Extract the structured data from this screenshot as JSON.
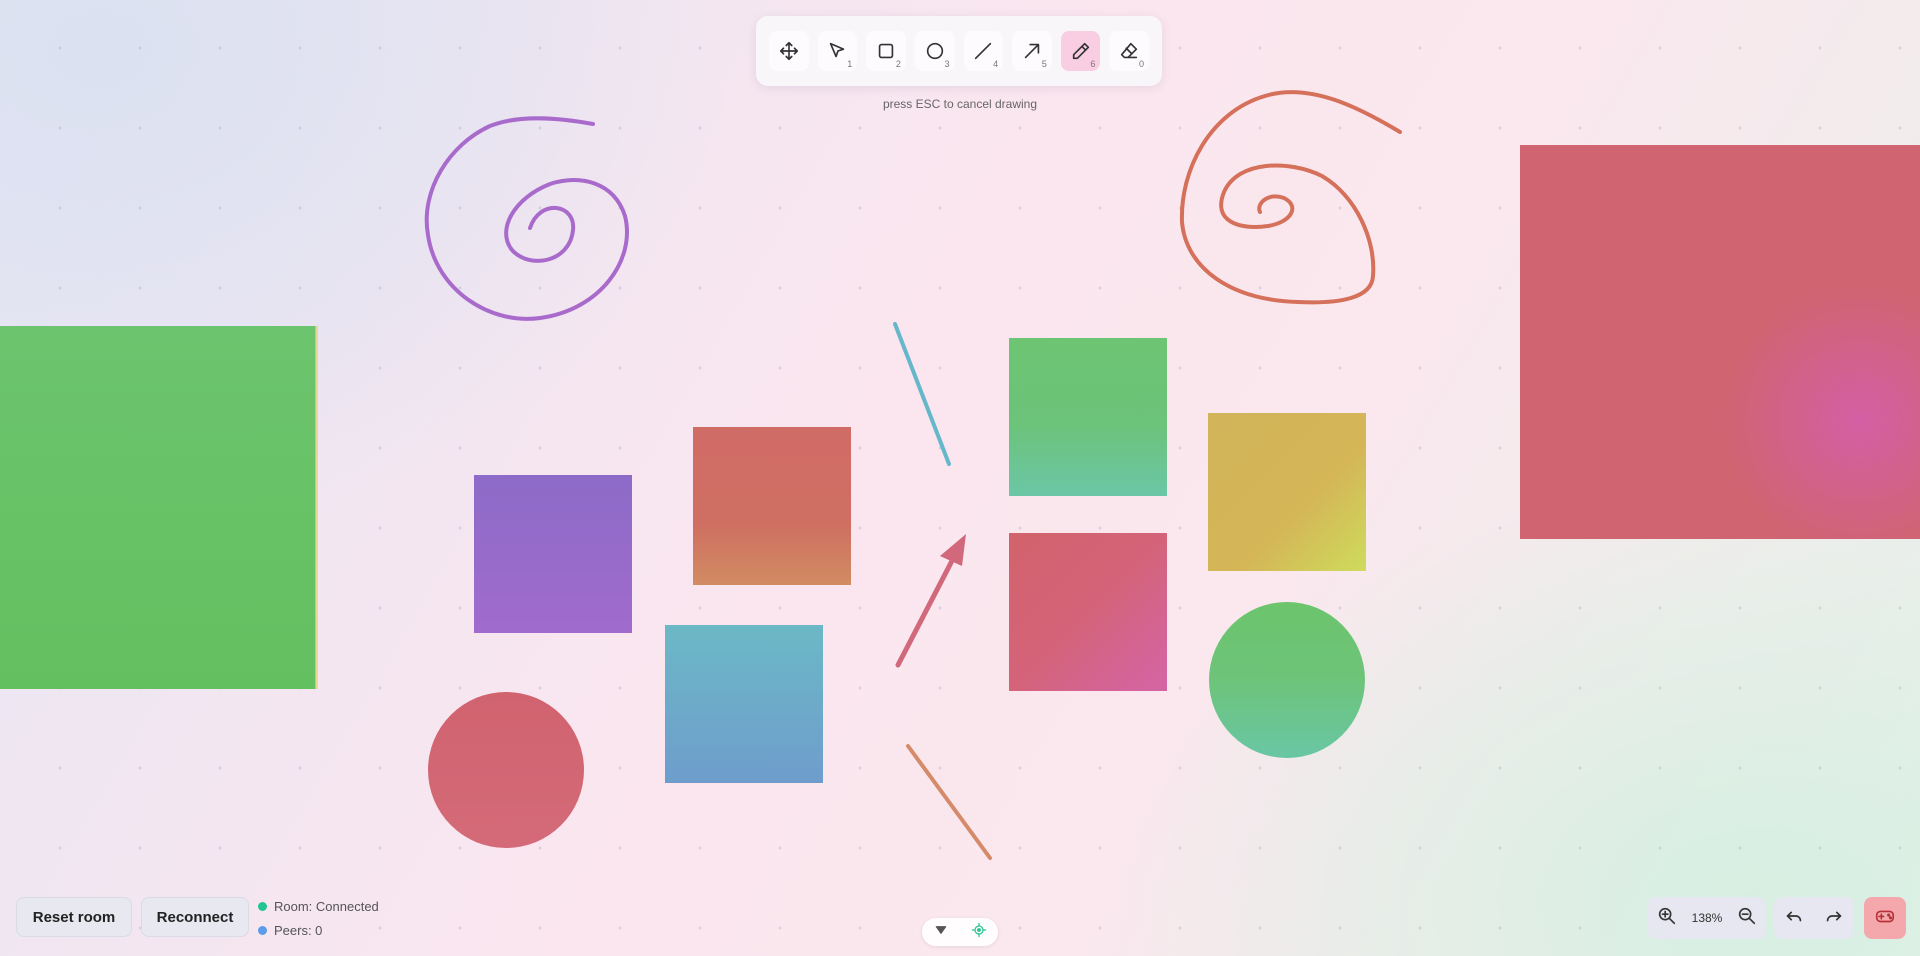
{
  "toolbar": {
    "tools": [
      {
        "name": "pan",
        "icon": "move-icon",
        "key": ""
      },
      {
        "name": "select",
        "icon": "pointer-icon",
        "key": "1"
      },
      {
        "name": "rectangle",
        "icon": "square-icon",
        "key": "2"
      },
      {
        "name": "ellipse",
        "icon": "circle-icon",
        "key": "3"
      },
      {
        "name": "line",
        "icon": "line-icon",
        "key": "4"
      },
      {
        "name": "arrow",
        "icon": "arrow-icon",
        "key": "5"
      },
      {
        "name": "pencil",
        "icon": "pencil-icon",
        "key": "6",
        "active": true
      },
      {
        "name": "eraser",
        "icon": "eraser-icon",
        "key": "0"
      }
    ],
    "hint": "press ESC to cancel drawing"
  },
  "footer": {
    "reset_label": "Reset room",
    "reconnect_label": "Reconnect",
    "room_status": "Room: Connected",
    "peers": "Peers: 0",
    "room_status_color": "#22c48f",
    "peers_color": "#5b9be8",
    "zoom": "138%"
  },
  "canvas": {
    "colors": {
      "green": "#6cc46e",
      "purple": "#8f6bc8",
      "orange": "#cf6c5e",
      "blue": "#6aaec8",
      "red": "#d1626f",
      "yellow": "#d2b55a",
      "pink": "#d45f96",
      "teal": "#69c7a4",
      "spiral_left": "#a96bcb",
      "spiral_right": "#d5705a",
      "cyan_line": "#65b7c9",
      "arrow": "#d1687b"
    }
  }
}
